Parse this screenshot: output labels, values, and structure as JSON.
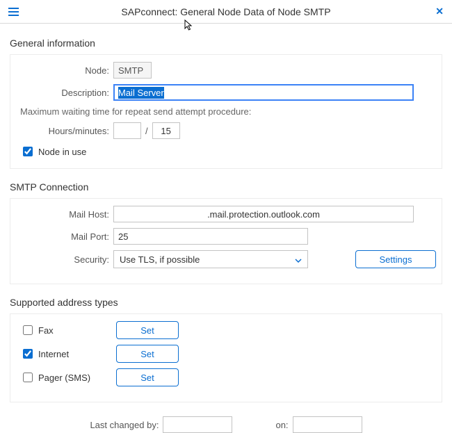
{
  "header": {
    "title": "SAPconnect: General Node Data of Node SMTP"
  },
  "general": {
    "section_title": "General information",
    "node_label": "Node:",
    "node_value": "SMTP",
    "description_label": "Description:",
    "description_value": "Mail Server",
    "wait_text": "Maximum waiting time for repeat send attempt procedure:",
    "hm_label": "Hours/minutes:",
    "hours_value": "",
    "minutes_value": "15",
    "in_use_label": "Node in use",
    "in_use_checked": true
  },
  "smtp": {
    "section_title": "SMTP Connection",
    "host_label": "Mail Host:",
    "host_value": ".mail.protection.outlook.com",
    "port_label": "Mail Port:",
    "port_value": "25",
    "security_label": "Security:",
    "security_value": "Use TLS, if possible",
    "settings_label": "Settings"
  },
  "addr": {
    "section_title": "Supported address types",
    "rows": [
      {
        "label": "Fax",
        "checked": false,
        "btn": "Set"
      },
      {
        "label": "Internet",
        "checked": true,
        "btn": "Set"
      },
      {
        "label": "Pager (SMS)",
        "checked": false,
        "btn": "Set"
      }
    ]
  },
  "footer": {
    "changed_by_label": "Last changed by:",
    "changed_by_value": "",
    "on_label": "on:",
    "on_value": ""
  }
}
